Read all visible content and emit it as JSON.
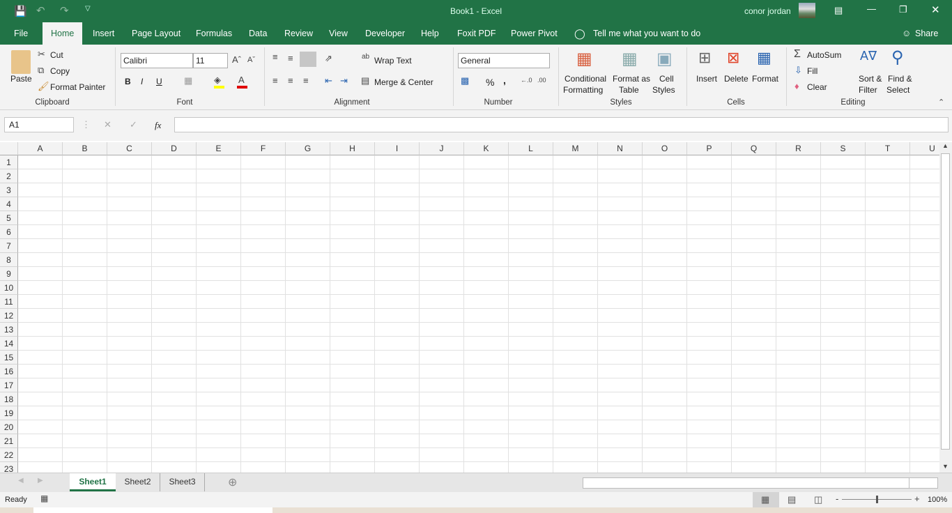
{
  "title_bar": {
    "title": "Book1  -  Excel",
    "user": "conor jordan"
  },
  "tabs": [
    "File",
    "Home",
    "Insert",
    "Page Layout",
    "Formulas",
    "Data",
    "Review",
    "View",
    "Developer",
    "Help",
    "Foxit PDF",
    "Power Pivot"
  ],
  "active_tab": "Home",
  "tell_me": "Tell me what you want to do",
  "share": "Share",
  "ribbon": {
    "clipboard": {
      "label": "Clipboard",
      "paste": "Paste",
      "cut": "Cut",
      "copy": "Copy",
      "format_painter": "Format Painter"
    },
    "font": {
      "label": "Font",
      "font_name": "Calibri",
      "font_size": "11",
      "bold": "B",
      "italic": "I",
      "underline": "U",
      "font_color": "#e00000",
      "fill_color": "#ffff00"
    },
    "alignment": {
      "label": "Alignment",
      "wrap_text": "Wrap Text",
      "merge_center": "Merge & Center"
    },
    "number": {
      "label": "Number",
      "format": "General",
      "percent": "%",
      "comma": ","
    },
    "styles": {
      "label": "Styles",
      "conditional": [
        "Conditional",
        "Formatting"
      ],
      "format_table": [
        "Format as",
        "Table"
      ],
      "cell_styles": [
        "Cell",
        "Styles"
      ]
    },
    "cells": {
      "label": "Cells",
      "insert": "Insert",
      "delete": "Delete",
      "format": "Format"
    },
    "editing": {
      "label": "Editing",
      "autosum": "AutoSum",
      "fill": "Fill",
      "clear": "Clear",
      "sort": [
        "Sort &",
        "Filter"
      ],
      "find": [
        "Find &",
        "Select"
      ]
    }
  },
  "formula_bar": {
    "name_box": "A1",
    "fx": "fx",
    "value": ""
  },
  "columns": [
    "A",
    "B",
    "C",
    "D",
    "E",
    "F",
    "G",
    "H",
    "I",
    "J",
    "K",
    "L",
    "M",
    "N",
    "O",
    "P",
    "Q",
    "R",
    "S",
    "T",
    "U"
  ],
  "rows": [
    "1",
    "2",
    "3",
    "4",
    "5",
    "6",
    "7",
    "8",
    "9",
    "10",
    "11",
    "12",
    "13",
    "14",
    "15",
    "16",
    "17",
    "18",
    "19",
    "20",
    "21",
    "22",
    "23"
  ],
  "sheets": [
    "Sheet1",
    "Sheet2",
    "Sheet3"
  ],
  "active_sheet": "Sheet1",
  "status": {
    "ready": "Ready",
    "zoom": "100%",
    "zoom_level": 100
  },
  "colors": {
    "brand": "#217346"
  }
}
